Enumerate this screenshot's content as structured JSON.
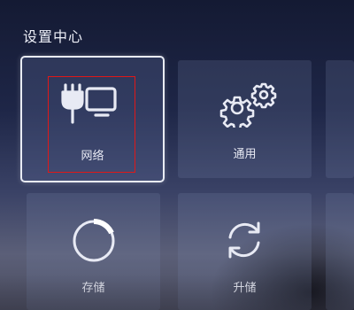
{
  "header": {
    "title": "设置中心"
  },
  "tiles": {
    "network": {
      "label": "网络",
      "icon": "network-icon"
    },
    "general": {
      "label": "通用",
      "icon": "gear-icon"
    },
    "storage": {
      "label": "存储",
      "icon": "storage-ring-icon"
    },
    "upgrade": {
      "label": "升储",
      "icon": "refresh-icon"
    }
  },
  "selected_tile": "network",
  "colors": {
    "highlight_border": "#e9ecf5",
    "annotation_red": "#e01818"
  }
}
